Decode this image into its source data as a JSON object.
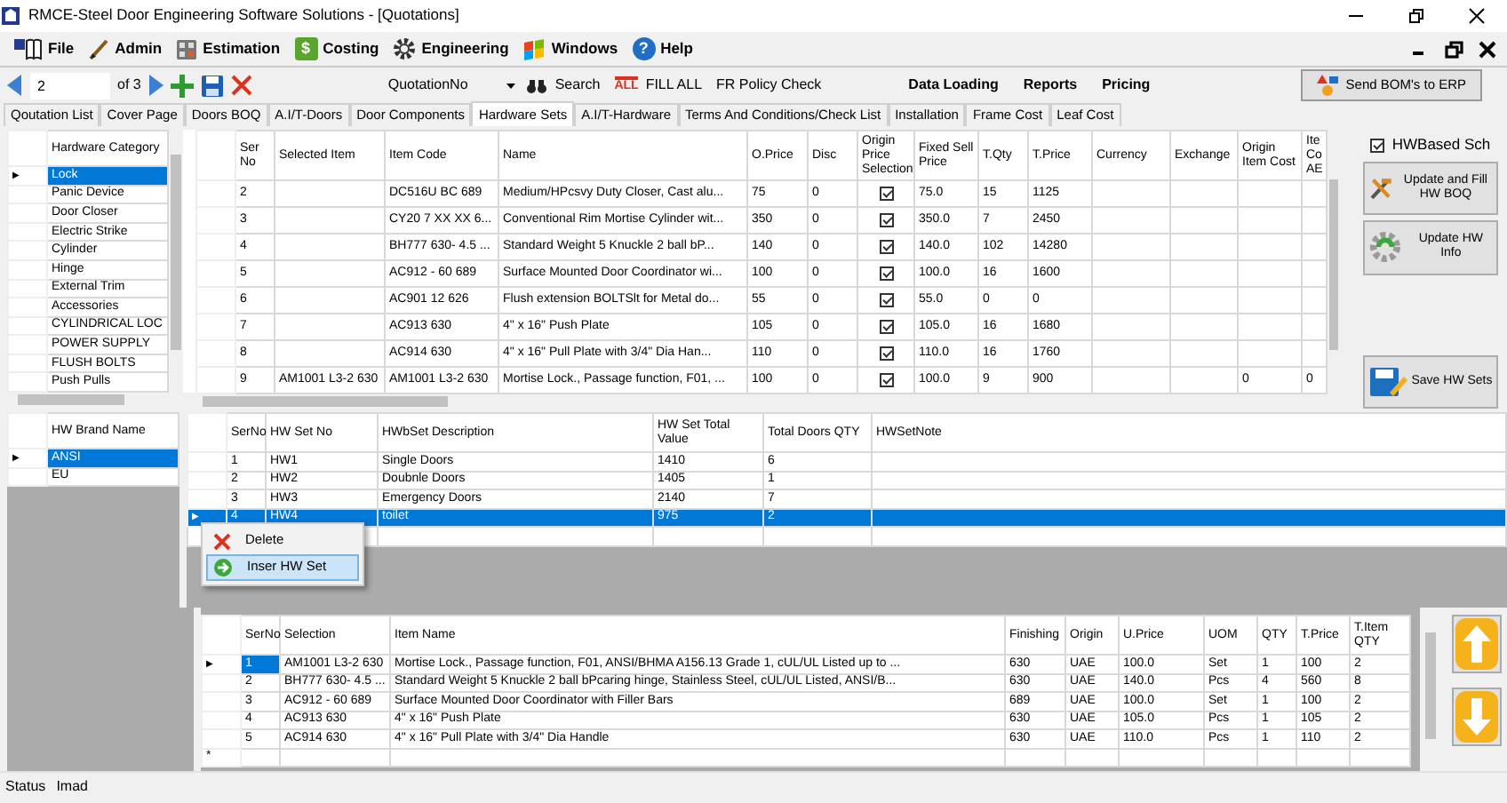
{
  "window": {
    "title": "RMCE-Steel Door Engineering Software Solutions - [Quotations]"
  },
  "menu": [
    {
      "label": "File"
    },
    {
      "label": "Admin"
    },
    {
      "label": "Estimation"
    },
    {
      "label": "Costing",
      "glyph": "$"
    },
    {
      "label": "Engineering"
    },
    {
      "label": "Windows"
    },
    {
      "label": "Help",
      "glyph": "?"
    }
  ],
  "toolbar": {
    "record": "2",
    "record_count": "of 3",
    "lookup": "QuotationNo",
    "search": "Search",
    "fill_icon_text": "ALL",
    "fill": "FILL ALL",
    "policy": "FR Policy Check",
    "links": [
      "Data Loading",
      "Reports",
      "Pricing"
    ],
    "send": "Send BOM's to ERP"
  },
  "tabs": [
    {
      "label": "Qoutation List",
      "selected": false
    },
    {
      "label": "Cover Page",
      "selected": false
    },
    {
      "label": "Doors BOQ",
      "selected": false
    },
    {
      "label": "A.I/T-Doors",
      "selected": false
    },
    {
      "label": "Door Components",
      "selected": false
    },
    {
      "label": "Hardware Sets",
      "selected": true
    },
    {
      "label": "A.I/T-Hardware",
      "selected": false
    },
    {
      "label": "Terms And Conditions/Check List",
      "selected": false
    },
    {
      "label": "Installation",
      "selected": false
    },
    {
      "label": "Frame Cost",
      "selected": false
    },
    {
      "label": "Leaf Cost",
      "selected": false
    }
  ],
  "categories": {
    "header": "Hardware Category",
    "marker": "▶",
    "items": [
      {
        "label": "Lock",
        "selected": true
      },
      {
        "label": "Panic Device",
        "selected": false
      },
      {
        "label": "Door Closer",
        "selected": false
      },
      {
        "label": "Electric Strike",
        "selected": false
      },
      {
        "label": "Cylinder",
        "selected": false
      },
      {
        "label": "Hinge",
        "selected": false
      },
      {
        "label": "External Trim",
        "selected": false
      },
      {
        "label": "Accessories",
        "selected": false
      },
      {
        "label": "CYLINDRICAL LOC",
        "selected": false
      },
      {
        "label": "POWER SUPPLY",
        "selected": false
      },
      {
        "label": "FLUSH BOLTS",
        "selected": false
      },
      {
        "label": "Push Pulls",
        "selected": false
      }
    ]
  },
  "items_table": {
    "columns": [
      {
        "label": "Ser No",
        "kind": "text"
      },
      {
        "label": "Selected Item",
        "kind": "text"
      },
      {
        "label": "Item Code",
        "kind": "text"
      },
      {
        "label": "Name",
        "kind": "text"
      },
      {
        "label": "O.Price",
        "kind": "text"
      },
      {
        "label": "Disc",
        "kind": "text"
      },
      {
        "label": "Origin Price Selection",
        "kind": "check"
      },
      {
        "label": "Fixed Sell Price",
        "kind": "text"
      },
      {
        "label": "T.Qty",
        "kind": "text"
      },
      {
        "label": "T.Price",
        "kind": "text"
      },
      {
        "label": "Currency",
        "kind": "text"
      },
      {
        "label": "Exchange",
        "kind": "text"
      },
      {
        "label": "Origin Item Cost",
        "kind": "text"
      },
      {
        "label": "Ite Co AE",
        "kind": "text"
      }
    ],
    "rows": [
      {
        "cells": [
          "2",
          null,
          "DC516U BC 689",
          "Medium/HPcsvy Duty Closer, Cast alu...",
          "75",
          "0",
          true,
          "75.0",
          "15",
          "1125",
          null,
          null,
          null,
          null
        ]
      },
      {
        "cells": [
          "3",
          null,
          "CY20 7 XX XX 6...",
          "Conventional Rim Mortise Cylinder wit...",
          "350",
          "0",
          true,
          "350.0",
          "7",
          "2450",
          null,
          null,
          null,
          null
        ]
      },
      {
        "cells": [
          "4",
          null,
          "BH777 630- 4.5 ...",
          "Standard Weight 5 Knuckle 2 ball bP...",
          "140",
          "0",
          true,
          "140.0",
          "102",
          "14280",
          null,
          null,
          null,
          null
        ]
      },
      {
        "cells": [
          "5",
          null,
          "AC912 - 60 689",
          "Surface Mounted Door Coordinator wi...",
          "100",
          "0",
          true,
          "100.0",
          "16",
          "1600",
          null,
          null,
          null,
          null
        ]
      },
      {
        "cells": [
          "6",
          null,
          "AC901 12 626",
          "Flush extension BOLTSlt for Metal do...",
          "55",
          "0",
          true,
          "55.0",
          "0",
          "0",
          null,
          null,
          null,
          null
        ]
      },
      {
        "cells": [
          "7",
          null,
          "AC913 630",
          "4\" x 16\" Push Plate",
          "105",
          "0",
          true,
          "105.0",
          "16",
          "1680",
          null,
          null,
          null,
          null
        ]
      },
      {
        "cells": [
          "8",
          null,
          "AC914 630",
          "4\" x 16\" Pull Plate with 3/4\" Dia Han...",
          "110",
          "0",
          true,
          "110.0",
          "16",
          "1760",
          null,
          null,
          null,
          null
        ]
      },
      {
        "cells": [
          "9",
          "AM1001 L3-2 630",
          "AM1001 L3-2 630",
          "Mortise Lock., Passage function, F01, ...",
          "100",
          "0",
          true,
          "100.0",
          "9",
          "900",
          null,
          null,
          "0",
          "0"
        ]
      }
    ]
  },
  "side_panel": {
    "hw_based": {
      "label": "HWBased Sch",
      "checked": true
    },
    "buttons": [
      "Update and Fill HW BOQ",
      "Update HW Info",
      "Save HW Sets"
    ]
  },
  "brands": {
    "header": "HW Brand Name",
    "marker": "▶",
    "items": [
      {
        "label": "ANSI",
        "selected": true
      },
      {
        "label": "EU",
        "selected": false
      }
    ]
  },
  "hw_sets": {
    "marker": "▶",
    "columns": [
      "SerNo",
      "HW Set No",
      "HWbSet Description",
      "HW Set Total Value",
      "Total Doors QTY",
      "HWSetNote"
    ],
    "rows": [
      {
        "cells": [
          "1",
          "HW1",
          "Single Doors",
          "1410",
          "6"
        ],
        "selected": false
      },
      {
        "cells": [
          "2",
          "HW2",
          "Doubnle Doors",
          "1405",
          "1"
        ],
        "selected": false
      },
      {
        "cells": [
          "3",
          "HW3",
          "Emergency Doors",
          "2140",
          "7"
        ],
        "selected": false
      },
      {
        "cells": [
          "4",
          "HW4",
          "toilet",
          "975",
          "2"
        ],
        "selected": true
      }
    ]
  },
  "context_menu": [
    {
      "label": "Delete",
      "kind": "delete",
      "highlighted": false
    },
    {
      "label": "Inser HW Set",
      "kind": "insert",
      "highlighted": true
    }
  ],
  "set_items": {
    "marker": "▶",
    "new_marker": "*",
    "columns": [
      "SerNo",
      "Selection",
      "Item Name",
      "Finishing",
      "Origin",
      "U.Price",
      "UOM",
      "QTY",
      "T.Price",
      "T.Item QTY"
    ],
    "rows": [
      {
        "cells": [
          "1",
          "AM1001 L3-2 630",
          "Mortise Lock., Passage function, F01, ANSI/BHMA A156.13 Grade 1, cUL/UL Listed up to ...",
          "630",
          "UAE",
          "100.0",
          "Set",
          "1",
          "100",
          "2"
        ],
        "selected": true
      },
      {
        "cells": [
          "2",
          "BH777 630- 4.5 ...",
          "Standard Weight 5 Knuckle 2 ball bPcaring hinge, Stainless Steel, cUL/UL Listed, ANSI/B...",
          "630",
          "UAE",
          "140.0",
          "Pcs",
          "4",
          "560",
          "8"
        ],
        "selected": false
      },
      {
        "cells": [
          "3",
          "AC912 - 60 689",
          "Surface Mounted Door Coordinator with Filler Bars",
          "689",
          "UAE",
          "100.0",
          "Set",
          "1",
          "100",
          "2"
        ],
        "selected": false
      },
      {
        "cells": [
          "4",
          "AC913 630",
          "4\" x 16\" Push Plate",
          "630",
          "UAE",
          "105.0",
          "Pcs",
          "1",
          "105",
          "2"
        ],
        "selected": false
      },
      {
        "cells": [
          "5",
          "AC914 630",
          "4\" x 16\" Pull Plate with 3/4\" Dia Handle",
          "630",
          "UAE",
          "110.0",
          "Pcs",
          "1",
          "110",
          "2"
        ],
        "selected": false
      }
    ]
  },
  "status_bar": {
    "label": "Status",
    "user": "Imad"
  }
}
